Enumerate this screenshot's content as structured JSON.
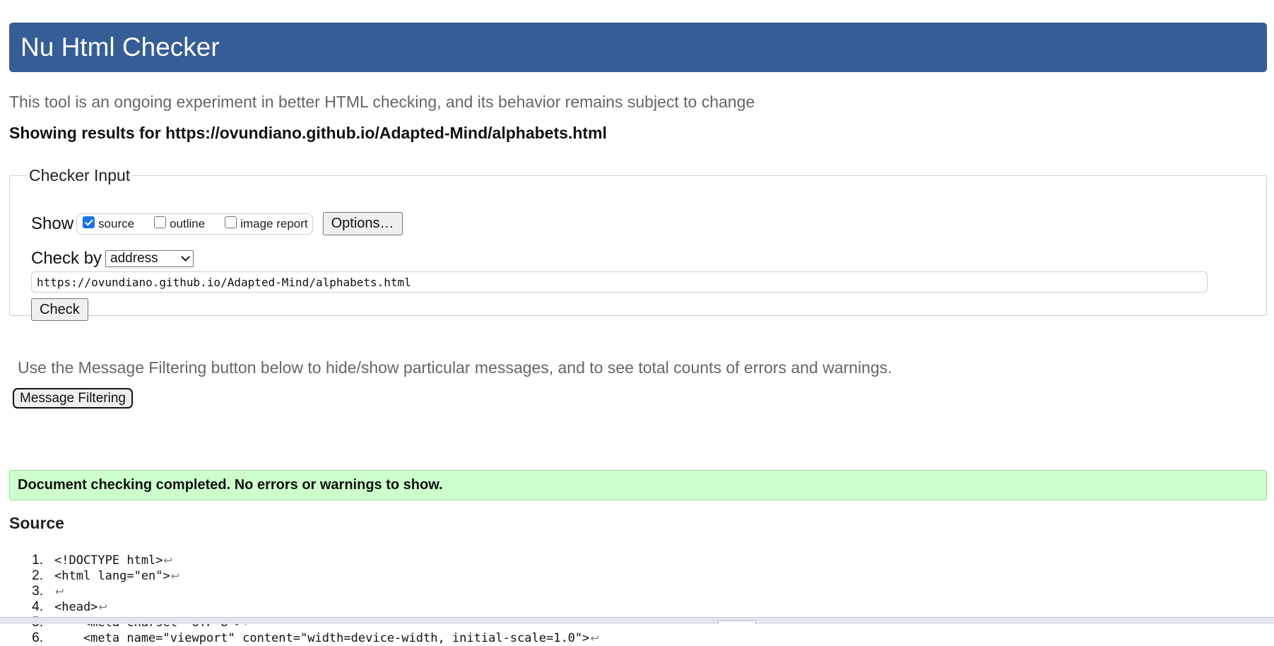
{
  "header": {
    "title": "Nu Html Checker"
  },
  "subtitle": "This tool is an ongoing experiment in better HTML checking, and its behavior remains subject to change",
  "results_for": "Showing results for https://ovundiano.github.io/Adapted-Mind/alphabets.html",
  "checker_input": {
    "legend": "Checker Input",
    "show_label": "Show",
    "show_options": [
      {
        "label": "source",
        "checked": true
      },
      {
        "label": "outline",
        "checked": false
      },
      {
        "label": "image report",
        "checked": false
      }
    ],
    "options_button": "Options…",
    "check_by_label": "Check by",
    "check_by_value": "address",
    "url_value": "https://ovundiano.github.io/Adapted-Mind/alphabets.html",
    "check_button": "Check"
  },
  "filter_note": "Use the Message Filtering button below to hide/show particular messages, and to see total counts of errors and warnings.",
  "filter_button": "Message Filtering",
  "status_message": "Document checking completed. No errors or warnings to show.",
  "source": {
    "title": "Source",
    "eol_symbol": "↩",
    "lines": [
      {
        "num": "1.",
        "code": "<!DOCTYPE html>"
      },
      {
        "num": "2.",
        "code": "<html lang=\"en\">"
      },
      {
        "num": "3.",
        "code": ""
      },
      {
        "num": "4.",
        "code": "<head>"
      },
      {
        "num": "5.",
        "code": "    <meta charset=\"UTF-8\">"
      },
      {
        "num": "6.",
        "code": "    <meta name=\"viewport\" content=\"width=device-width, initial-scale=1.0\">"
      }
    ]
  },
  "colors": {
    "header_bg": "#365d95",
    "success_bg": "#ccffcc",
    "muted_text": "#666666"
  }
}
